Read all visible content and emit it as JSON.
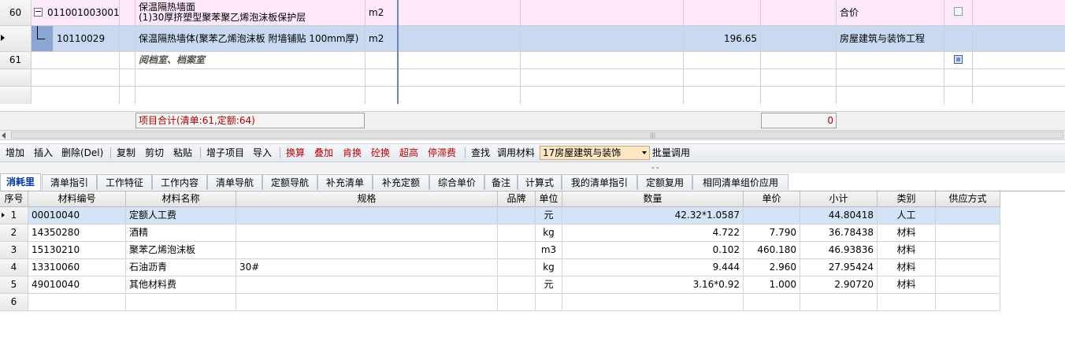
{
  "top_rows": [
    {
      "row_no": "60",
      "code": "011001003001",
      "name_line1": "保温隔热墙面",
      "name_line2": "(1)30厚挤塑型聚苯聚乙烯泡沫板保护层",
      "unit": "m2",
      "quantity": "",
      "category": "合价",
      "expand_icon": "minus-box-icon"
    },
    {
      "row_no": "",
      "code": "10110029",
      "name": "保温隔热墙体(聚苯乙烯泡沫板 附墙铺贴 100mm厚)",
      "unit": "m2",
      "quantity": "196.65",
      "category": "房屋建筑与装饰工程"
    },
    {
      "row_no": "61",
      "code": "",
      "name": "阅档室、档案室",
      "unit": "",
      "quantity": "",
      "category": ""
    }
  ],
  "summary": {
    "label": "项目合计(清单:61,定额:64)",
    "value": "0"
  },
  "toolbar": {
    "buttons": [
      "增加",
      "插入",
      "删除(Del)",
      "复制",
      "剪切",
      "粘贴",
      "增子项目",
      "导入",
      "换算",
      "叠加",
      "肯换",
      "砼换",
      "超高",
      "停滞费",
      "查找",
      "调用材料"
    ],
    "select_value": "17房屋建筑与装饰",
    "batch_label": "批量调用"
  },
  "tabs": [
    "消耗里",
    "清单指引",
    "工作特征",
    "工作内容",
    "清单导航",
    "定额导航",
    "补充清单",
    "补充定额",
    "综合单价",
    "备注",
    "计算式",
    "我的清单指引",
    "定额复用",
    "相同清单组价应用"
  ],
  "material_table": {
    "headers": [
      "序号",
      "材料编号",
      "材料名称",
      "规格",
      "品牌",
      "单位",
      "数量",
      "单价",
      "小计",
      "类别",
      "供应方式"
    ],
    "rows": [
      {
        "seq": "1",
        "code": "00010040",
        "name": "定额人工费",
        "spec": "",
        "brand": "",
        "unit": "元",
        "qty": "42.32*1.0587",
        "price": "",
        "subtotal": "44.80418",
        "type": "人工",
        "supply": ""
      },
      {
        "seq": "2",
        "code": "14350280",
        "name": "酒精",
        "spec": "",
        "brand": "",
        "unit": "kg",
        "qty": "4.722",
        "price": "7.790",
        "subtotal": "36.78438",
        "type": "材料",
        "supply": ""
      },
      {
        "seq": "3",
        "code": "15130210",
        "name": "聚苯乙烯泡沫板",
        "spec": "",
        "brand": "",
        "unit": "m3",
        "qty": "0.102",
        "price": "460.180",
        "subtotal": "46.93836",
        "type": "材料",
        "supply": ""
      },
      {
        "seq": "4",
        "code": "13310060",
        "name": "石油沥青",
        "spec": "30#",
        "brand": "",
        "unit": "kg",
        "qty": "9.444",
        "price": "2.960",
        "subtotal": "27.95424",
        "type": "材料",
        "supply": ""
      },
      {
        "seq": "5",
        "code": "49010040",
        "name": "其他材料费",
        "spec": "",
        "brand": "",
        "unit": "元",
        "qty": "3.16*0.92",
        "price": "1.000",
        "subtotal": "2.90720",
        "type": "材料",
        "supply": ""
      },
      {
        "seq": "6",
        "code": "",
        "name": "",
        "spec": "",
        "brand": "",
        "unit": "",
        "qty": "",
        "price": "",
        "subtotal": "",
        "type": "",
        "supply": ""
      }
    ]
  },
  "colors": {
    "row60_bg": "#fce8f8",
    "selected_row_bg": "#c9d9f1",
    "tab_active_text": "#0033aa",
    "red_button": "#c00000",
    "select_bg": "#fde6c4"
  }
}
